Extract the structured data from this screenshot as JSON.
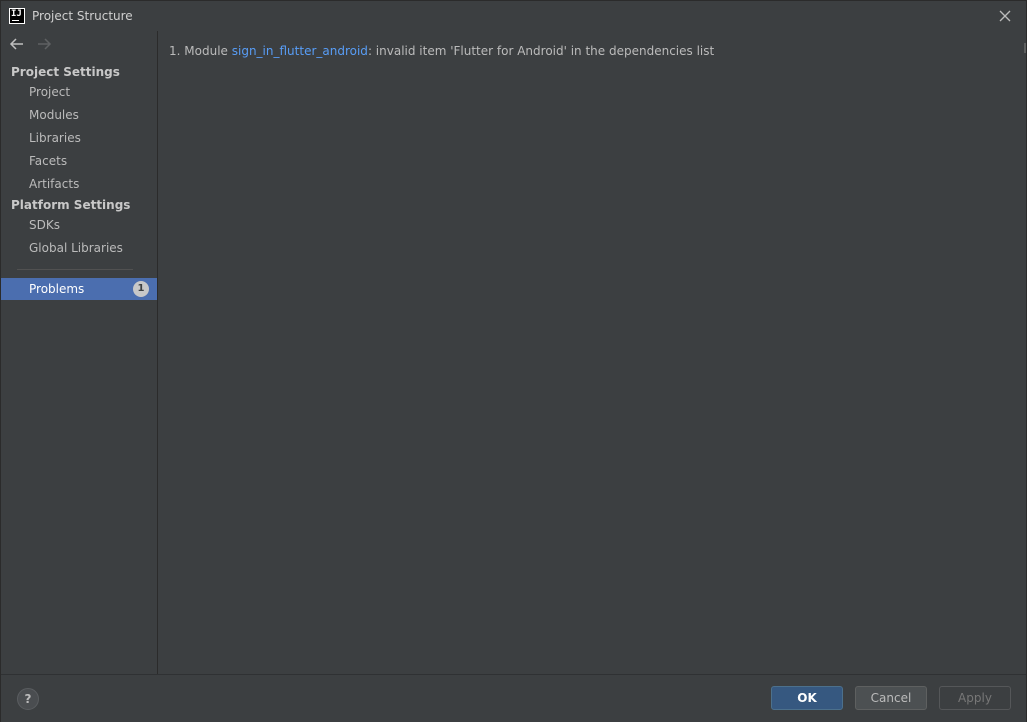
{
  "window": {
    "title": "Project Structure",
    "app_icon_text": "IJ"
  },
  "sidebar": {
    "project_settings_header": "Project Settings",
    "project_settings_items": [
      {
        "label": "Project"
      },
      {
        "label": "Modules"
      },
      {
        "label": "Libraries"
      },
      {
        "label": "Facets"
      },
      {
        "label": "Artifacts"
      }
    ],
    "platform_settings_header": "Platform Settings",
    "platform_settings_items": [
      {
        "label": "SDKs"
      },
      {
        "label": "Global Libraries"
      }
    ],
    "problems": {
      "label": "Problems",
      "count": "1"
    }
  },
  "main": {
    "problems": [
      {
        "number": "1.",
        "prefix": "Module",
        "module_link": "sign_in_flutter_android",
        "message": ": invalid item 'Flutter for Android' in the dependencies list"
      }
    ]
  },
  "footer": {
    "help_label": "?",
    "ok_label": "OK",
    "cancel_label": "Cancel",
    "apply_label": "Apply"
  },
  "colors": {
    "background": "#3c3f41",
    "selection": "#4b6eaf",
    "link": "#589df6",
    "primary_button": "#365880"
  },
  "icons": [
    "app-icon",
    "close-icon",
    "back-arrow-icon",
    "forward-arrow-icon",
    "help-icon"
  ]
}
